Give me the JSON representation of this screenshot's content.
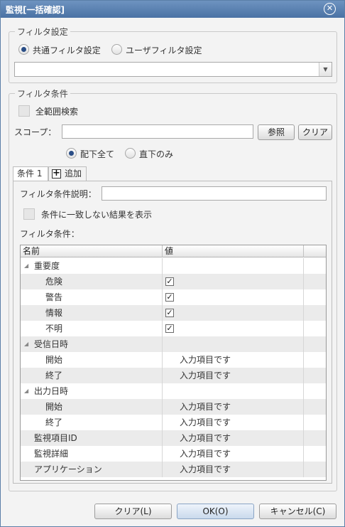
{
  "window": {
    "title": "監視[一括確認]"
  },
  "filter_settings": {
    "legend": "フィルタ設定",
    "common_label": "共通フィルタ設定",
    "user_label": "ユーザフィルタ設定",
    "selected": "common",
    "combo_value": ""
  },
  "filter_conditions": {
    "legend": "フィルタ条件",
    "full_search_label": "全範囲検索",
    "scope_label": "スコープ：",
    "scope_value": "",
    "browse_button": "参照",
    "clear_button": "クリア",
    "all_below_label": "配下全て",
    "direct_only_label": "直下のみ",
    "scope_mode": "all_below"
  },
  "tabs": {
    "condition_tab": "条件 1",
    "add_label": "追加"
  },
  "condition": {
    "description_label": "フィルタ条件説明：",
    "description_value": "",
    "invert_label": "条件に一致しない結果を表示",
    "conditions_label": "フィルタ条件："
  },
  "grid": {
    "col_name": "名前",
    "col_value": "値",
    "rows": [
      {
        "name": "重要度",
        "indent": 1,
        "group": true,
        "value": ""
      },
      {
        "name": "危険",
        "indent": 2,
        "checked": true,
        "value": ""
      },
      {
        "name": "警告",
        "indent": 2,
        "checked": true,
        "value": ""
      },
      {
        "name": "情報",
        "indent": 2,
        "checked": true,
        "value": ""
      },
      {
        "name": "不明",
        "indent": 2,
        "checked": true,
        "value": ""
      },
      {
        "name": "受信日時",
        "indent": 1,
        "group": true,
        "value": ""
      },
      {
        "name": "開始",
        "indent": 2,
        "value": "入力項目です"
      },
      {
        "name": "終了",
        "indent": 2,
        "value": "入力項目です"
      },
      {
        "name": "出力日時",
        "indent": 1,
        "group": true,
        "value": ""
      },
      {
        "name": "開始",
        "indent": 2,
        "value": "入力項目です"
      },
      {
        "name": "終了",
        "indent": 2,
        "value": "入力項目です"
      },
      {
        "name": "監視項目ID",
        "indent": 0,
        "value": "入力項目です"
      },
      {
        "name": "監視詳細",
        "indent": 0,
        "value": "入力項目です"
      },
      {
        "name": "アプリケーション",
        "indent": 0,
        "value": "入力項目です"
      }
    ]
  },
  "footer": {
    "clear_button": "クリア(L)",
    "ok_button": "OK(O)",
    "cancel_button": "キャンセル(C)"
  }
}
